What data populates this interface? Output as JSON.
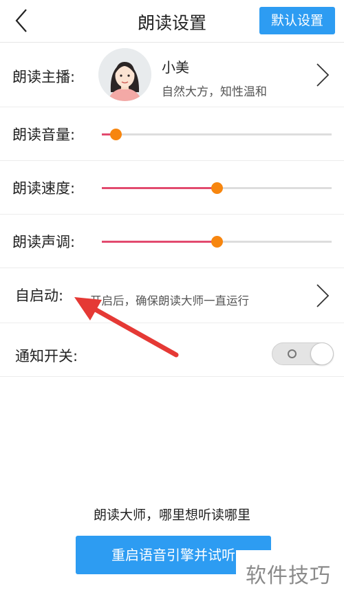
{
  "header": {
    "title": "朗读设置",
    "default_button": "默认设置"
  },
  "anchor": {
    "label": "朗读主播:",
    "name": "小美",
    "description": "自然大方，知性温和"
  },
  "volume": {
    "label": "朗读音量:",
    "value_percent": 6
  },
  "speed": {
    "label": "朗读速度:",
    "value_percent": 50
  },
  "pitch": {
    "label": "朗读声调:",
    "value_percent": 50
  },
  "autostart": {
    "label": "自启动:",
    "description": "开启后，确保朗读大师一直运行"
  },
  "notification": {
    "label": "通知开关:",
    "enabled": false
  },
  "footer": {
    "slogan": "朗读大师，哪里想听读哪里",
    "restart_button": "重启语音引擎并试听"
  },
  "watermark": {
    "text": "软件技巧"
  },
  "colors": {
    "accent_blue": "#2d9cf2",
    "slider_fill": "#e24a6e",
    "slider_thumb": "#f7860f",
    "annotation_arrow": "#e53935"
  },
  "icons": {
    "back": "chevron-left-icon",
    "more": "chevron-right-icon",
    "avatar": "avatar-icon",
    "toggle": "circle-icon"
  }
}
